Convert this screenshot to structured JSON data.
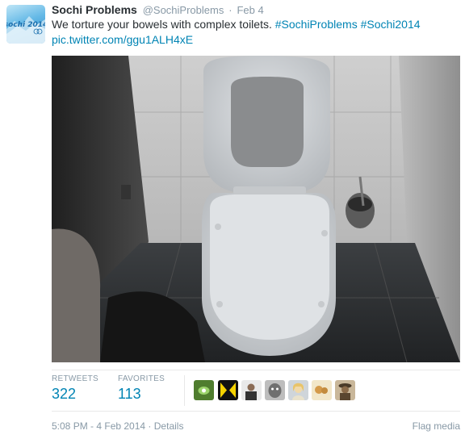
{
  "tweet": {
    "avatar_icon": "sochi-2014-logo-avatar",
    "avatar_logo_text": "sochi 2014",
    "fullname": "Sochi Problems",
    "username": "@SochiProblems",
    "separator": "·",
    "date": "Feb 4",
    "text_plain": "We torture your bowels with complex toilets. ",
    "hashtag1": "#SochiProblems",
    "hashtag2": "#Sochi2014",
    "pic_link": "pic.twitter.com/ggu1ALH4xE",
    "link_color": "#0084b4"
  },
  "stats": {
    "retweets_label": "RETWEETS",
    "retweets_count": "322",
    "favorites_label": "FAVORITES",
    "favorites_count": "113"
  },
  "favoriters": [
    {
      "icon": "favoriter-avatar-1"
    },
    {
      "icon": "favoriter-avatar-2"
    },
    {
      "icon": "favoriter-avatar-3"
    },
    {
      "icon": "favoriter-avatar-4"
    },
    {
      "icon": "favoriter-avatar-5"
    },
    {
      "icon": "favoriter-avatar-6"
    },
    {
      "icon": "favoriter-avatar-7"
    }
  ],
  "footer": {
    "timestamp": "5:08 PM - 4 Feb 2014",
    "separator": "·",
    "details_label": "Details",
    "flag_label": "Flag media"
  }
}
